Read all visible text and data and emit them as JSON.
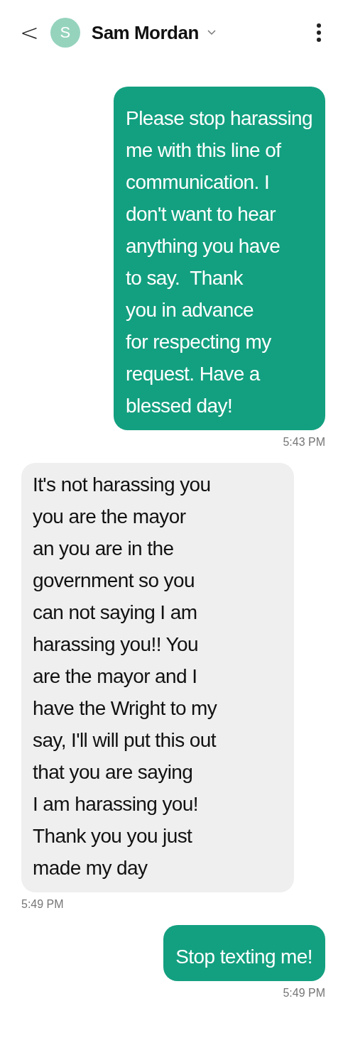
{
  "header": {
    "back": "<",
    "avatar_letter": "S",
    "contact": "Sam Mordan"
  },
  "messages": [
    {
      "kind": "sent",
      "text": "Please stop harassing\nme with this line of\ncommunication. I\ndon't want to hear\nanything you have\nto say.  Thank\nyou in advance\nfor respecting my\nrequest. Have a\nblessed day!",
      "time": "5:43 PM"
    },
    {
      "kind": "received",
      "text": "It's not harassing you\nyou are the mayor\nan you are in the\ngovernment so you\ncan not saying I am\nharassing you!! You\nare the mayor and I\nhave the Wright to my\nsay, I'll will put this out\nthat you are saying\nI am harassing you!\nThank you you just\nmade my day",
      "time": "5:49 PM"
    },
    {
      "kind": "sent",
      "text": "Stop texting me!",
      "time": "5:49 PM"
    }
  ]
}
